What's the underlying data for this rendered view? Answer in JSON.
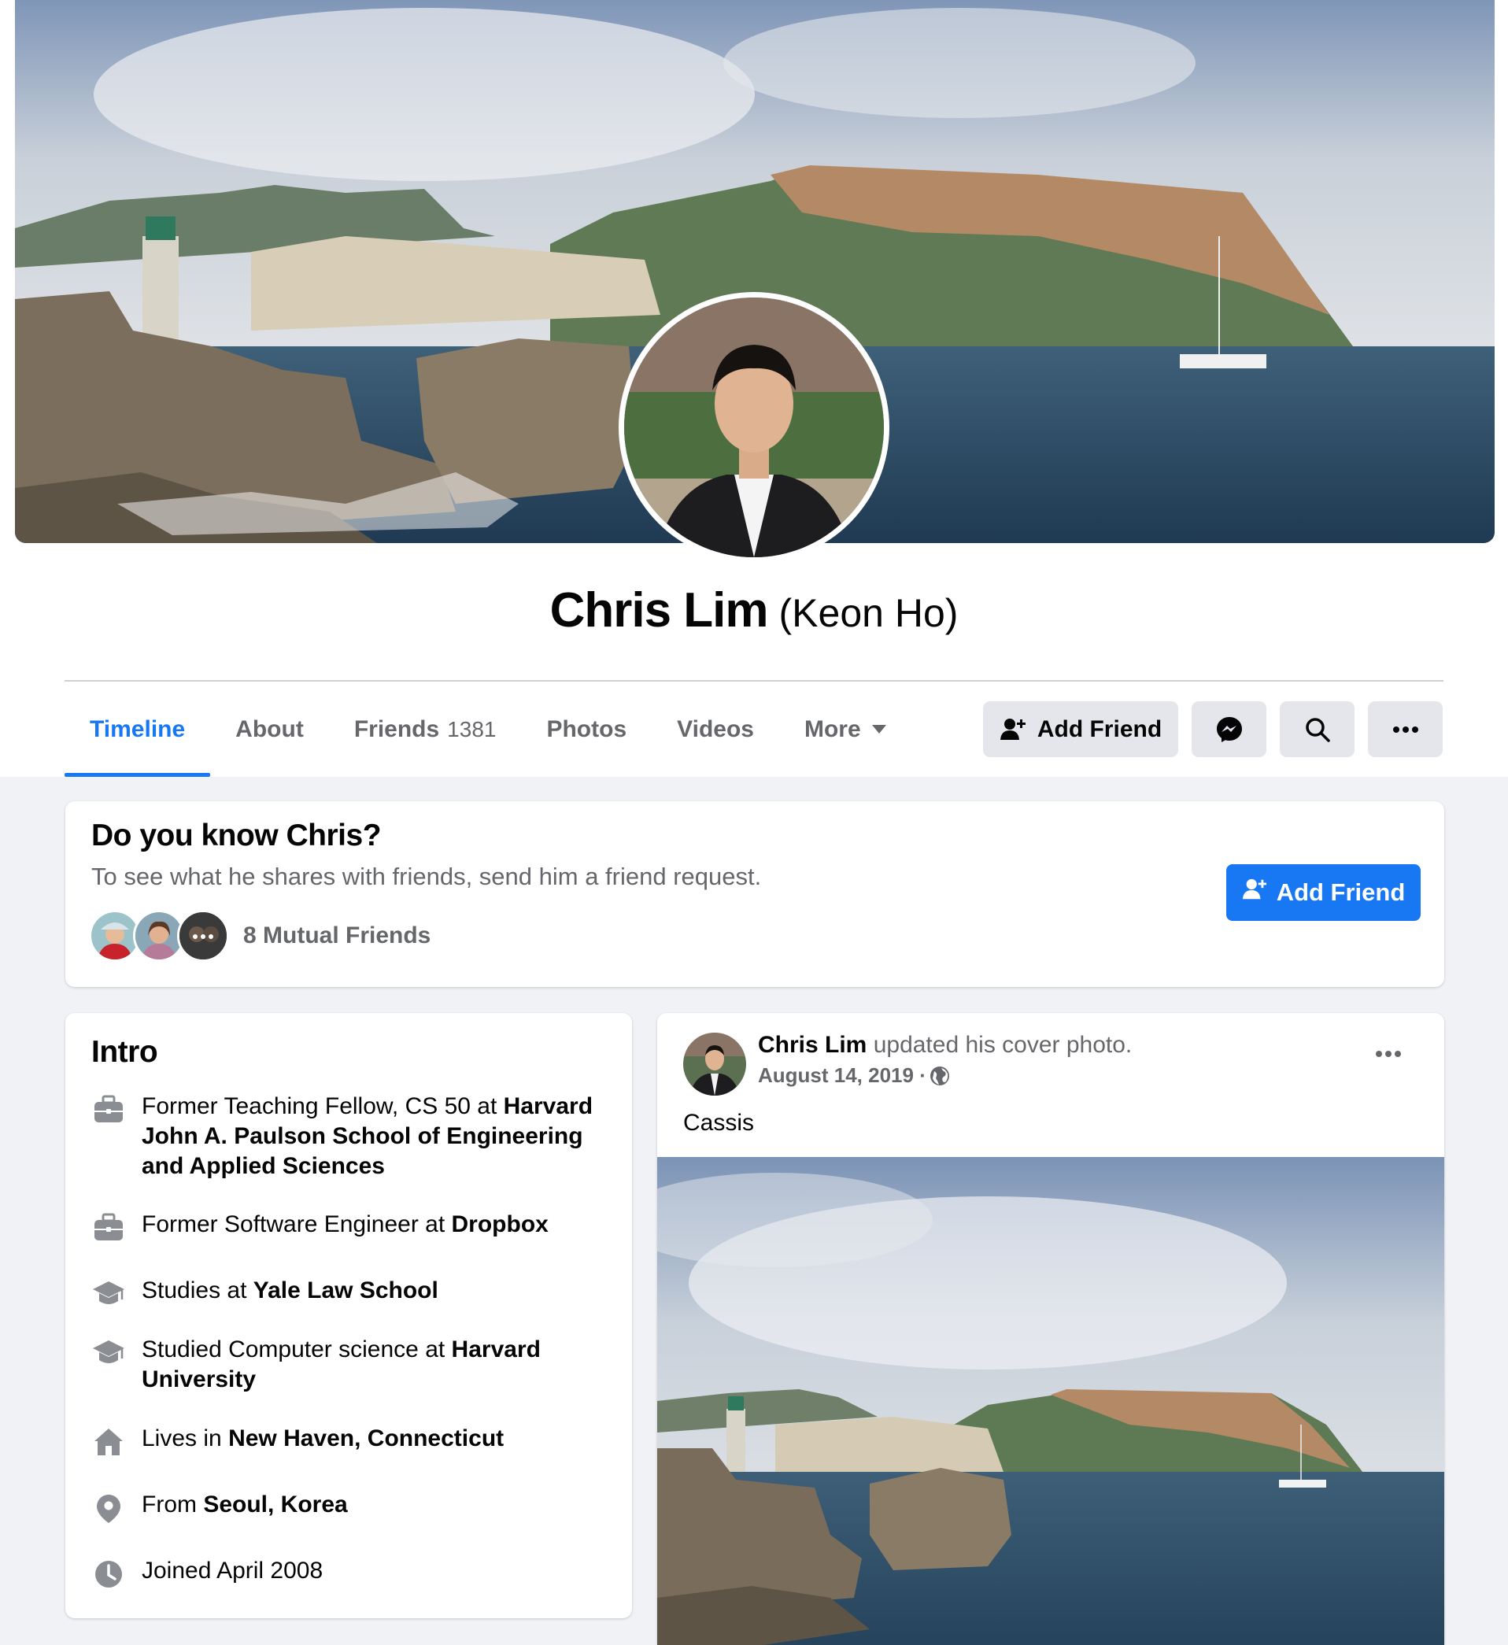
{
  "profile": {
    "name": "Chris Lim",
    "alternate_name": "(Keon Ho)"
  },
  "tabs": [
    {
      "label": "Timeline",
      "active": true
    },
    {
      "label": "About"
    },
    {
      "label": "Friends",
      "count": "1381"
    },
    {
      "label": "Photos"
    },
    {
      "label": "Videos"
    },
    {
      "label": "More"
    }
  ],
  "actions": {
    "add_friend": "Add Friend",
    "messenger_icon": "messenger-icon",
    "search_icon": "search-icon",
    "more_icon": "ellipsis-icon"
  },
  "know_card": {
    "title": "Do you know Chris?",
    "subtitle": "To see what he shares with friends, send him a friend request.",
    "mutual_friends": "8 Mutual Friends",
    "button": "Add Friend",
    "more_avatars": "…"
  },
  "intro": {
    "title": "Intro",
    "items": [
      {
        "icon": "briefcase-icon",
        "prefix": "Former Teaching Fellow, CS 50 at ",
        "bold": "Harvard John A. Paulson School of Engineering and Applied Sciences"
      },
      {
        "icon": "briefcase-icon",
        "prefix": "Former Software Engineer at ",
        "bold": "Dropbox"
      },
      {
        "icon": "graduation-cap-icon",
        "prefix": "Studies at ",
        "bold": "Yale Law School"
      },
      {
        "icon": "graduation-cap-icon",
        "prefix": "Studied Computer science at ",
        "bold": "Harvard University"
      },
      {
        "icon": "home-icon",
        "prefix": "Lives in ",
        "bold": "New Haven, Connecticut"
      },
      {
        "icon": "location-pin-icon",
        "prefix": "From ",
        "bold": "Seoul, Korea"
      },
      {
        "icon": "clock-icon",
        "prefix": "Joined April 2008",
        "bold": ""
      }
    ]
  },
  "post": {
    "author": "Chris Lim",
    "action": " updated his cover photo.",
    "date": "August 14, 2019 · ",
    "privacy_icon": "globe-icon",
    "caption": "Cassis"
  },
  "colors": {
    "accent": "#1877f2",
    "page_bg": "#f0f2f5",
    "secondary_text": "#65676b",
    "button_gray": "#e4e6eb"
  }
}
